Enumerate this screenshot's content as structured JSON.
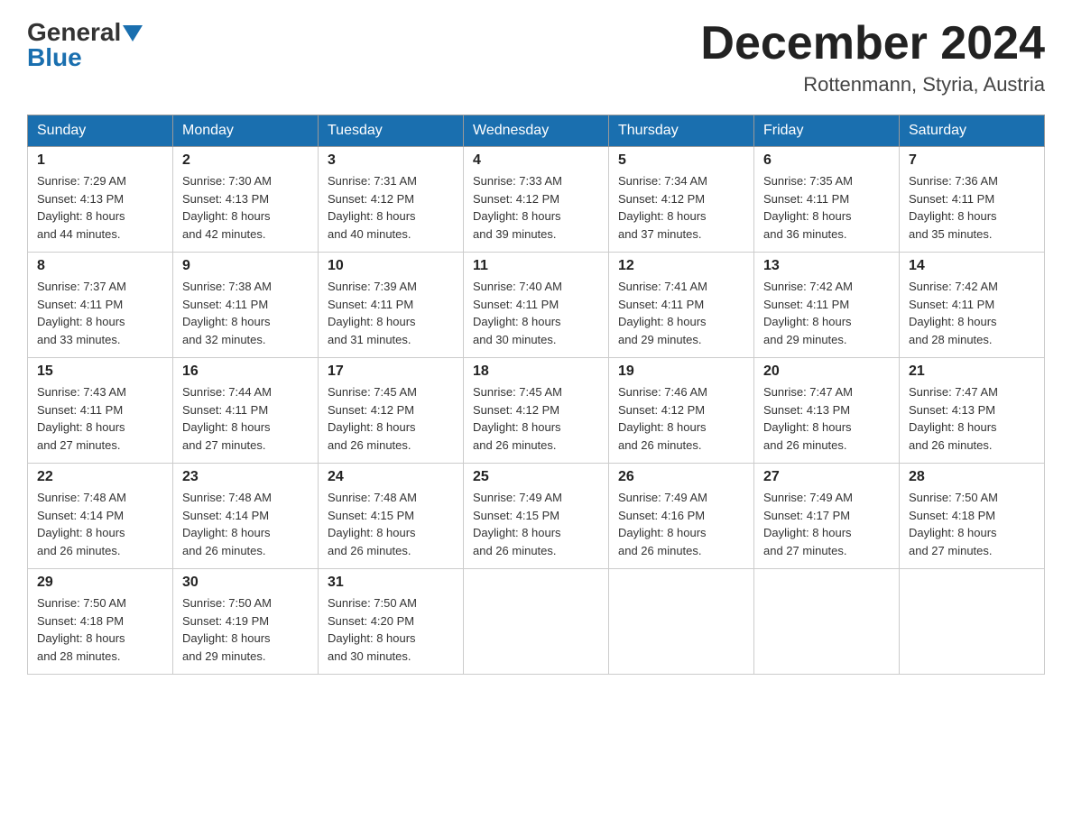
{
  "header": {
    "logo_general": "General",
    "logo_blue": "Blue",
    "month_title": "December 2024",
    "location": "Rottenmann, Styria, Austria"
  },
  "days_of_week": [
    "Sunday",
    "Monday",
    "Tuesday",
    "Wednesday",
    "Thursday",
    "Friday",
    "Saturday"
  ],
  "weeks": [
    [
      {
        "day": "1",
        "sunrise": "7:29 AM",
        "sunset": "4:13 PM",
        "daylight": "8 hours and 44 minutes."
      },
      {
        "day": "2",
        "sunrise": "7:30 AM",
        "sunset": "4:13 PM",
        "daylight": "8 hours and 42 minutes."
      },
      {
        "day": "3",
        "sunrise": "7:31 AM",
        "sunset": "4:12 PM",
        "daylight": "8 hours and 40 minutes."
      },
      {
        "day": "4",
        "sunrise": "7:33 AM",
        "sunset": "4:12 PM",
        "daylight": "8 hours and 39 minutes."
      },
      {
        "day": "5",
        "sunrise": "7:34 AM",
        "sunset": "4:12 PM",
        "daylight": "8 hours and 37 minutes."
      },
      {
        "day": "6",
        "sunrise": "7:35 AM",
        "sunset": "4:11 PM",
        "daylight": "8 hours and 36 minutes."
      },
      {
        "day": "7",
        "sunrise": "7:36 AM",
        "sunset": "4:11 PM",
        "daylight": "8 hours and 35 minutes."
      }
    ],
    [
      {
        "day": "8",
        "sunrise": "7:37 AM",
        "sunset": "4:11 PM",
        "daylight": "8 hours and 33 minutes."
      },
      {
        "day": "9",
        "sunrise": "7:38 AM",
        "sunset": "4:11 PM",
        "daylight": "8 hours and 32 minutes."
      },
      {
        "day": "10",
        "sunrise": "7:39 AM",
        "sunset": "4:11 PM",
        "daylight": "8 hours and 31 minutes."
      },
      {
        "day": "11",
        "sunrise": "7:40 AM",
        "sunset": "4:11 PM",
        "daylight": "8 hours and 30 minutes."
      },
      {
        "day": "12",
        "sunrise": "7:41 AM",
        "sunset": "4:11 PM",
        "daylight": "8 hours and 29 minutes."
      },
      {
        "day": "13",
        "sunrise": "7:42 AM",
        "sunset": "4:11 PM",
        "daylight": "8 hours and 29 minutes."
      },
      {
        "day": "14",
        "sunrise": "7:42 AM",
        "sunset": "4:11 PM",
        "daylight": "8 hours and 28 minutes."
      }
    ],
    [
      {
        "day": "15",
        "sunrise": "7:43 AM",
        "sunset": "4:11 PM",
        "daylight": "8 hours and 27 minutes."
      },
      {
        "day": "16",
        "sunrise": "7:44 AM",
        "sunset": "4:11 PM",
        "daylight": "8 hours and 27 minutes."
      },
      {
        "day": "17",
        "sunrise": "7:45 AM",
        "sunset": "4:12 PM",
        "daylight": "8 hours and 26 minutes."
      },
      {
        "day": "18",
        "sunrise": "7:45 AM",
        "sunset": "4:12 PM",
        "daylight": "8 hours and 26 minutes."
      },
      {
        "day": "19",
        "sunrise": "7:46 AM",
        "sunset": "4:12 PM",
        "daylight": "8 hours and 26 minutes."
      },
      {
        "day": "20",
        "sunrise": "7:47 AM",
        "sunset": "4:13 PM",
        "daylight": "8 hours and 26 minutes."
      },
      {
        "day": "21",
        "sunrise": "7:47 AM",
        "sunset": "4:13 PM",
        "daylight": "8 hours and 26 minutes."
      }
    ],
    [
      {
        "day": "22",
        "sunrise": "7:48 AM",
        "sunset": "4:14 PM",
        "daylight": "8 hours and 26 minutes."
      },
      {
        "day": "23",
        "sunrise": "7:48 AM",
        "sunset": "4:14 PM",
        "daylight": "8 hours and 26 minutes."
      },
      {
        "day": "24",
        "sunrise": "7:48 AM",
        "sunset": "4:15 PM",
        "daylight": "8 hours and 26 minutes."
      },
      {
        "day": "25",
        "sunrise": "7:49 AM",
        "sunset": "4:15 PM",
        "daylight": "8 hours and 26 minutes."
      },
      {
        "day": "26",
        "sunrise": "7:49 AM",
        "sunset": "4:16 PM",
        "daylight": "8 hours and 26 minutes."
      },
      {
        "day": "27",
        "sunrise": "7:49 AM",
        "sunset": "4:17 PM",
        "daylight": "8 hours and 27 minutes."
      },
      {
        "day": "28",
        "sunrise": "7:50 AM",
        "sunset": "4:18 PM",
        "daylight": "8 hours and 27 minutes."
      }
    ],
    [
      {
        "day": "29",
        "sunrise": "7:50 AM",
        "sunset": "4:18 PM",
        "daylight": "8 hours and 28 minutes."
      },
      {
        "day": "30",
        "sunrise": "7:50 AM",
        "sunset": "4:19 PM",
        "daylight": "8 hours and 29 minutes."
      },
      {
        "day": "31",
        "sunrise": "7:50 AM",
        "sunset": "4:20 PM",
        "daylight": "8 hours and 30 minutes."
      },
      null,
      null,
      null,
      null
    ]
  ],
  "labels": {
    "sunrise": "Sunrise:",
    "sunset": "Sunset:",
    "daylight": "Daylight:"
  }
}
